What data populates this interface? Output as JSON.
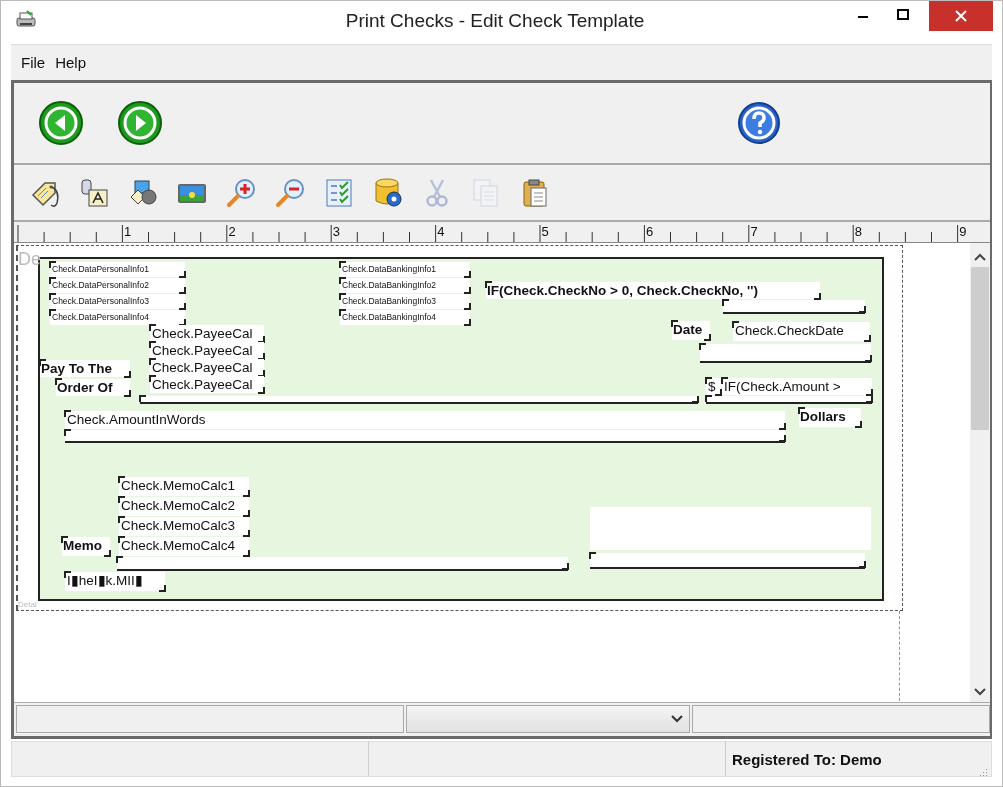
{
  "window": {
    "title": "Print Checks - Edit Check Template"
  },
  "menu": [
    {
      "label": "File"
    },
    {
      "label": "Help"
    }
  ],
  "nav_buttons": [
    {
      "kind": "back"
    },
    {
      "kind": "forward"
    },
    {
      "kind": "help"
    }
  ],
  "toolbar": [
    {
      "kind": "tag",
      "disabled": false
    },
    {
      "kind": "data-text",
      "disabled": false
    },
    {
      "kind": "shapes",
      "disabled": false
    },
    {
      "kind": "image",
      "disabled": false
    },
    {
      "kind": "zoom-in",
      "disabled": false
    },
    {
      "kind": "zoom-out",
      "disabled": false
    },
    {
      "kind": "checklist",
      "disabled": false
    },
    {
      "kind": "db-gear",
      "disabled": false
    },
    {
      "kind": "cut",
      "disabled": true
    },
    {
      "kind": "copy",
      "disabled": true
    },
    {
      "kind": "paste",
      "disabled": false
    }
  ],
  "ruler": {
    "labels": [
      "1",
      "2",
      "3",
      "4",
      "5",
      "6",
      "7",
      "8",
      "9"
    ]
  },
  "designer": {
    "band_labels": [
      "De",
      "Detai"
    ],
    "fields": [
      {
        "kind": "small",
        "text": "Check.DataPersonalInfo1"
      },
      {
        "kind": "small",
        "text": "Check.DataBankingInfo1"
      },
      {
        "kind": "small",
        "text": "Check.DataPersonalInfo2"
      },
      {
        "kind": "small",
        "text": "Check.DataBankingInfo2"
      },
      {
        "kind": "label",
        "text": "IF(Check.CheckNo > 0, Check.CheckNo, '')"
      },
      {
        "kind": "small",
        "text": "Check.DataPersonalInfo3"
      },
      {
        "kind": "small",
        "text": "Check.DataBankingInfo3"
      },
      {
        "kind": "line"
      },
      {
        "kind": "small",
        "text": "Check.DataPersonalInfo4"
      },
      {
        "kind": "small",
        "text": "Check.DataBankingInfo4"
      },
      {
        "kind": "field",
        "text": "Check.PayeeCal"
      },
      {
        "kind": "label",
        "text": "Date"
      },
      {
        "kind": "field",
        "text": "Check.CheckDate"
      },
      {
        "kind": "field",
        "text": "Check.PayeeCal"
      },
      {
        "kind": "line"
      },
      {
        "kind": "label",
        "text": "Pay To The"
      },
      {
        "kind": "field",
        "text": "Check.PayeeCal"
      },
      {
        "kind": "label",
        "text": "Order Of"
      },
      {
        "kind": "field",
        "text": "Check.PayeeCal"
      },
      {
        "kind": "field",
        "text": "$"
      },
      {
        "kind": "field",
        "text": "IF(Check.Amount >"
      },
      {
        "kind": "line"
      },
      {
        "kind": "line"
      },
      {
        "kind": "field",
        "text": "Check.AmountInWords"
      },
      {
        "kind": "label",
        "text": "Dollars"
      },
      {
        "kind": "line"
      },
      {
        "kind": "field",
        "text": "Check.MemoCalc1"
      },
      {
        "kind": "field",
        "text": "Check.MemoCalc2"
      },
      {
        "kind": "blank"
      },
      {
        "kind": "field",
        "text": "Check.MemoCalc3"
      },
      {
        "kind": "label",
        "text": "Memo"
      },
      {
        "kind": "field",
        "text": "Check.MemoCalc4"
      },
      {
        "kind": "line"
      },
      {
        "kind": "line"
      },
      {
        "kind": "field",
        "text": "I▮heI▮k.MII▮"
      }
    ]
  },
  "bottom_fields": [
    {
      "kind": "text"
    },
    {
      "kind": "dropdown"
    },
    {
      "kind": "text"
    }
  ],
  "status_bar": {
    "text": "Registered To: Demo"
  }
}
